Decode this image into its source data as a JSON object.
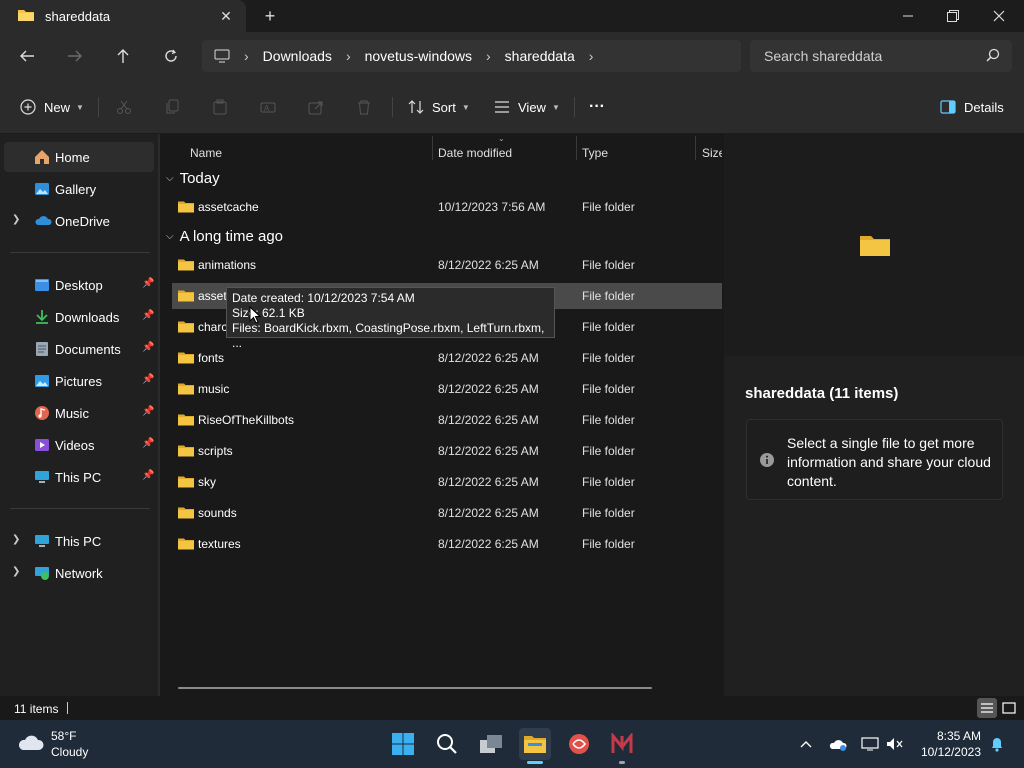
{
  "window": {
    "tab_title": "shareddata",
    "new_tab_label": "+"
  },
  "address_bar": {
    "crumbs": [
      "Downloads",
      "novetus-windows",
      "shareddata"
    ],
    "search_placeholder": "Search shareddata"
  },
  "command_bar": {
    "new_label": "New",
    "sort_label": "Sort",
    "view_label": "View",
    "more_label": "···",
    "details_label": "Details"
  },
  "sidebar": {
    "items": [
      {
        "label": "Home",
        "icon": "home-icon",
        "selected": true
      },
      {
        "label": "Gallery",
        "icon": "gallery-icon"
      },
      {
        "label": "OneDrive",
        "icon": "onedrive-icon",
        "expandable": true
      },
      {
        "label": "Desktop",
        "icon": "desktop-icon",
        "pinned": true
      },
      {
        "label": "Downloads",
        "icon": "downloads-icon",
        "pinned": true
      },
      {
        "label": "Documents",
        "icon": "documents-icon",
        "pinned": true
      },
      {
        "label": "Pictures",
        "icon": "pictures-icon",
        "pinned": true
      },
      {
        "label": "Music",
        "icon": "music-icon",
        "pinned": true
      },
      {
        "label": "Videos",
        "icon": "videos-icon",
        "pinned": true
      },
      {
        "label": "This PC",
        "icon": "this-pc-icon",
        "pinned": true
      },
      {
        "label": "This PC",
        "icon": "this-pc-icon",
        "expandable": true
      },
      {
        "label": "Network",
        "icon": "network-icon",
        "expandable": true
      }
    ]
  },
  "columns": {
    "name": "Name",
    "date": "Date modified",
    "type": "Type",
    "size": "Size"
  },
  "groups": {
    "today": "Today",
    "long_ago": "A long time ago"
  },
  "files_today": [
    {
      "name": "assetcache",
      "date": "10/12/2023 7:56 AM",
      "type": "File folder"
    }
  ],
  "files_old": [
    {
      "name": "animations",
      "date": "8/12/2022 6:25 AM",
      "type": "File folder"
    },
    {
      "name": "assets",
      "date": "",
      "type": "File folder"
    },
    {
      "name": "charcustom",
      "date": "",
      "type": "File folder"
    },
    {
      "name": "fonts",
      "date": "8/12/2022 6:25 AM",
      "type": "File folder"
    },
    {
      "name": "music",
      "date": "8/12/2022 6:25 AM",
      "type": "File folder"
    },
    {
      "name": "RiseOfTheKillbots",
      "date": "8/12/2022 6:25 AM",
      "type": "File folder"
    },
    {
      "name": "scripts",
      "date": "8/12/2022 6:25 AM",
      "type": "File folder"
    },
    {
      "name": "sky",
      "date": "8/12/2022 6:25 AM",
      "type": "File folder"
    },
    {
      "name": "sounds",
      "date": "8/12/2022 6:25 AM",
      "type": "File folder"
    },
    {
      "name": "textures",
      "date": "8/12/2022 6:25 AM",
      "type": "File folder"
    }
  ],
  "tooltip": {
    "line1": "Date created: 10/12/2023 7:54 AM",
    "line2": "Size: 62.1 KB",
    "line3": "Files: BoardKick.rbxm, CoastingPose.rbxm, LeftTurn.rbxm, ..."
  },
  "details_pane": {
    "title": "shareddata (11 items)",
    "message": "Select a single file to get more information and share your cloud content."
  },
  "status": {
    "item_count": "11 items"
  },
  "taskbar": {
    "weather_temp": "58°F",
    "weather_desc": "Cloudy",
    "time": "8:35 AM",
    "date": "10/12/2023"
  },
  "colors": {
    "folder": "#f4c542",
    "accent": "#60cdff",
    "background": "#191919",
    "chrome": "#2b2b2b"
  }
}
